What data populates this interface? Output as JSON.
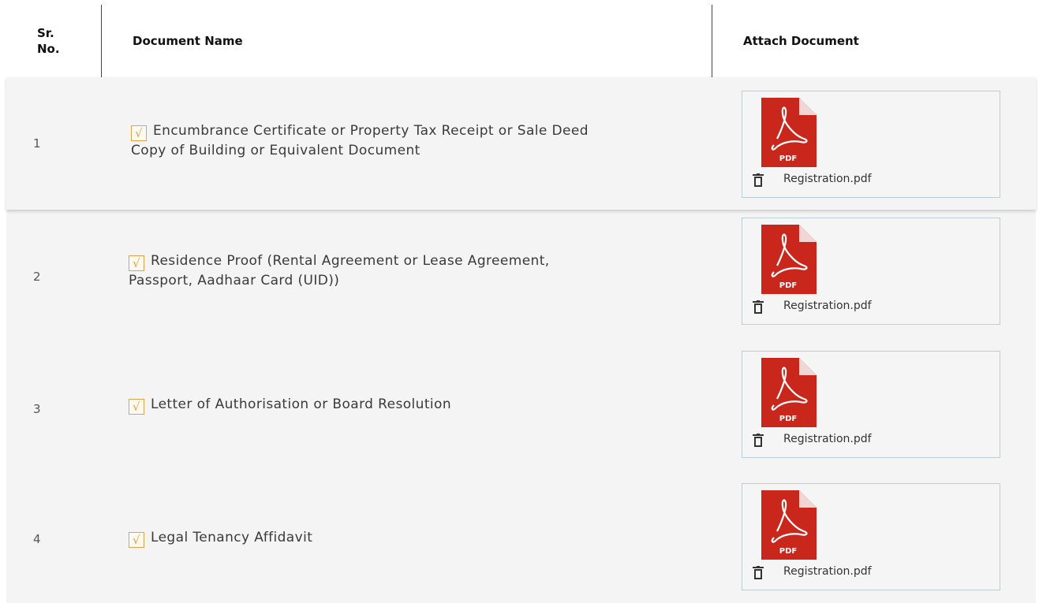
{
  "table": {
    "headers": {
      "sr_no": "Sr.\nNo.",
      "document_name": "Document Name",
      "attach_document": "Attach Document"
    },
    "rows": [
      {
        "sr": "1",
        "checked": true,
        "check_glyph": "√",
        "line1": "Encumbrance Certificate or Property Tax Receipt or Sale Deed",
        "line2": "Copy of Building or Equivalent Document",
        "file_icon": "pdf-icon",
        "file_label": "PDF",
        "file_name": "Registration.pdf"
      },
      {
        "sr": "2",
        "checked": true,
        "check_glyph": "√",
        "line1": "Residence Proof (Rental Agreement or Lease Agreement,",
        "line2": "Passport, Aadhaar Card (UID))",
        "file_icon": "pdf-icon",
        "file_label": "PDF",
        "file_name": "Registration.pdf"
      },
      {
        "sr": "3",
        "checked": true,
        "check_glyph": "√",
        "line1": "Letter of Authorisation or Board Resolution",
        "line2": "",
        "file_icon": "pdf-icon",
        "file_label": "PDF",
        "file_name": "Registration.pdf"
      },
      {
        "sr": "4",
        "checked": true,
        "check_glyph": "√",
        "line1": "Legal Tenancy Affidavit",
        "line2": "",
        "file_icon": "pdf-icon",
        "file_label": "PDF",
        "file_name": "Registration.pdf"
      }
    ]
  },
  "colors": {
    "checkbox_accent": "#e2a24a",
    "pdf_red": "#c9261c",
    "attach_border": "#b9cfd4",
    "row_background": "#f4f4f4"
  }
}
